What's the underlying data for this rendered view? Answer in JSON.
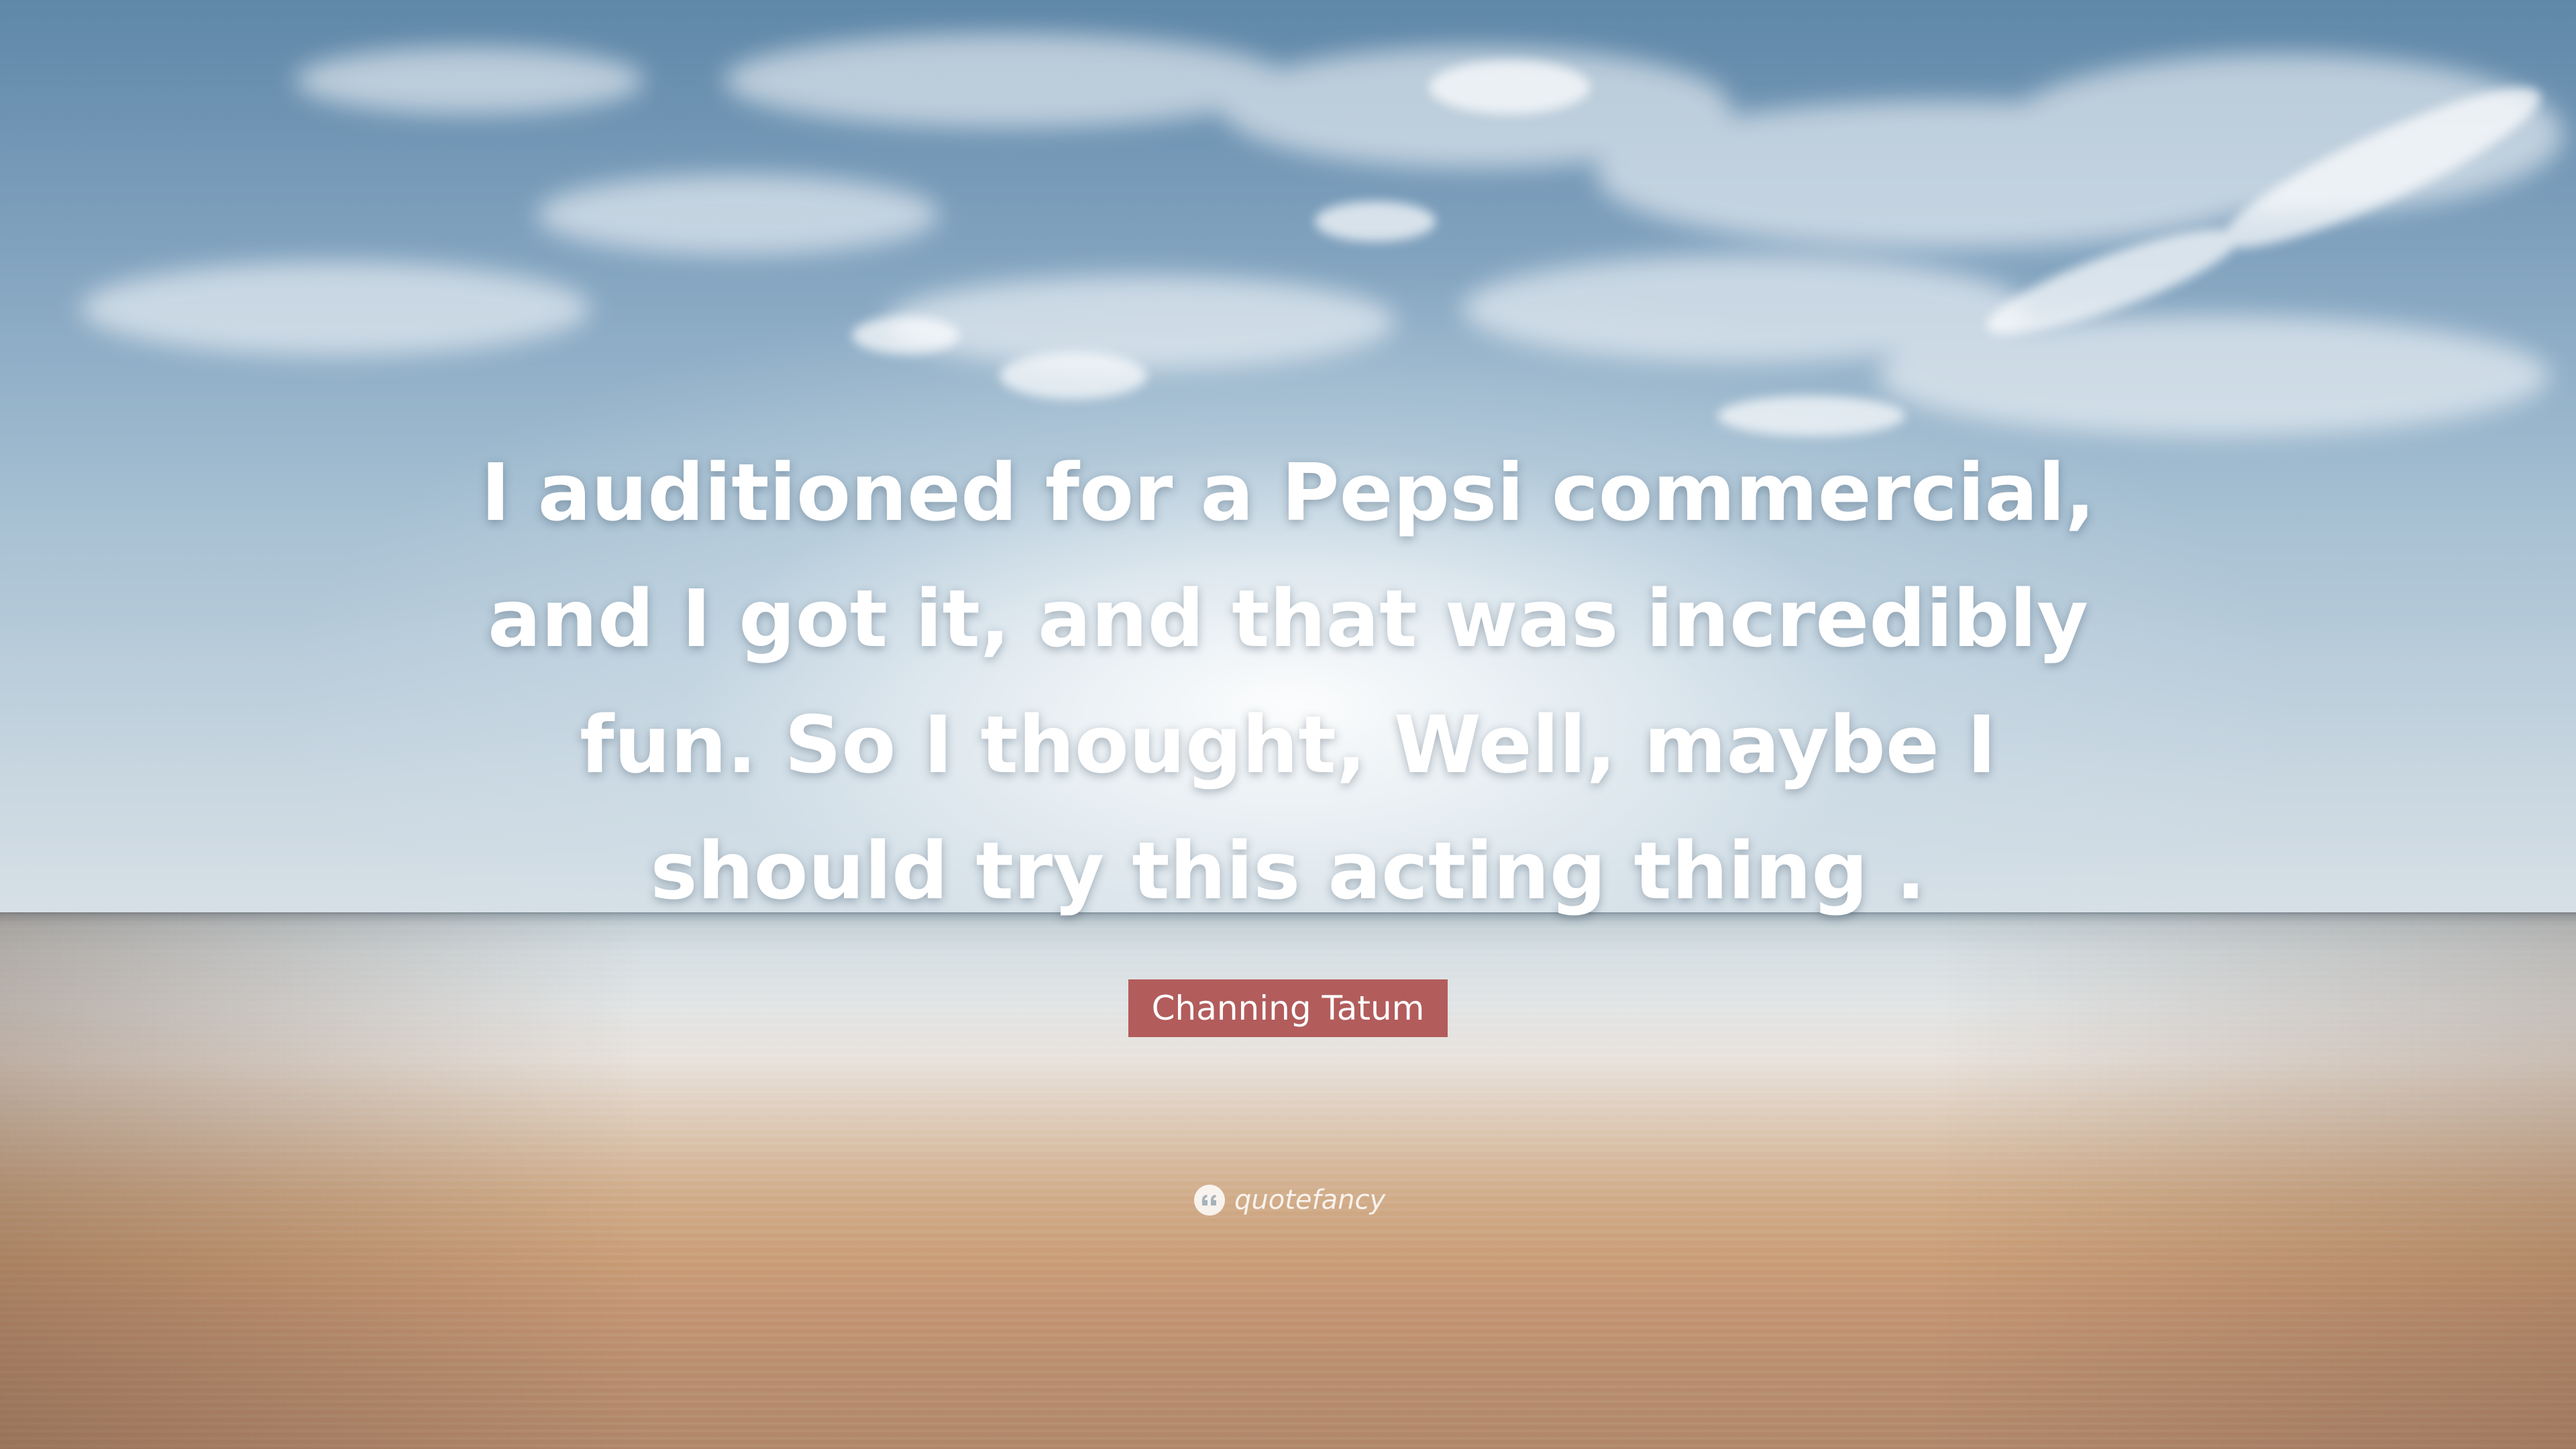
{
  "quote": {
    "text": "I auditioned for a Pepsi commercial, and I got it, and that was incredibly fun. So I thought, Well, maybe I should try this acting thing ."
  },
  "author": {
    "name": "Channing Tatum",
    "badge_color": "#b25c5c"
  },
  "brand": {
    "name": "quotefancy",
    "icon": "quote-marks-icon"
  }
}
